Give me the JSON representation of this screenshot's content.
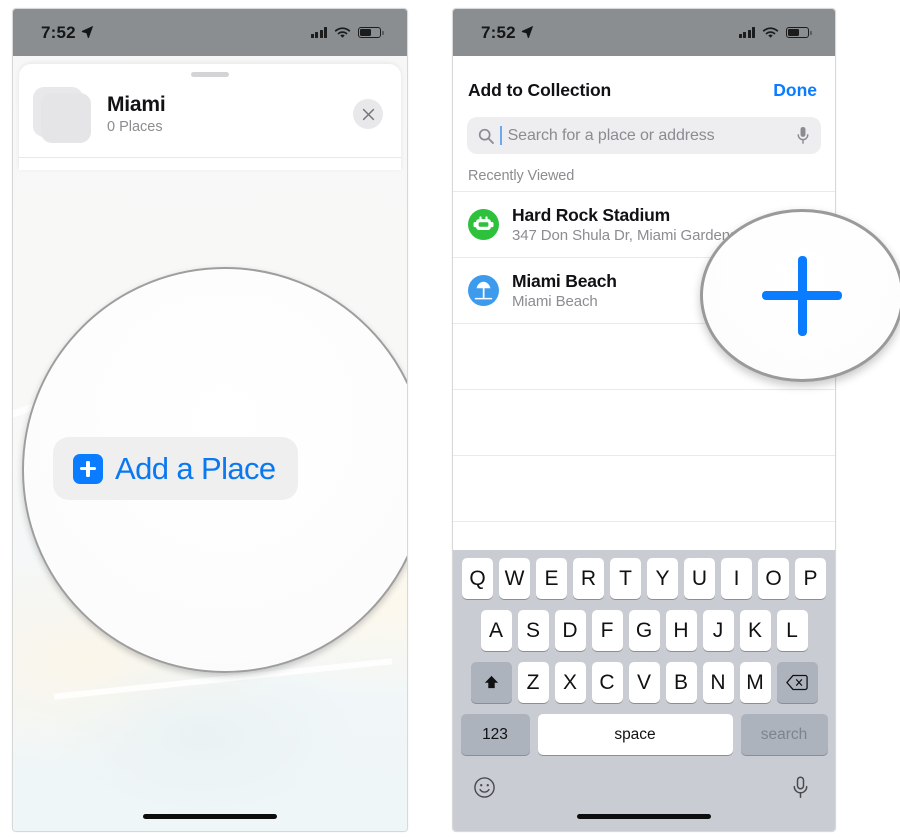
{
  "status_bar": {
    "time": "7:52",
    "location_arrow_icon": "location-arrow-icon",
    "cellular_icon": "cellular-bars-icon",
    "wifi_icon": "wifi-icon",
    "battery_icon": "battery-icon"
  },
  "left_screen": {
    "collection": {
      "title": "Miami",
      "subtitle": "0 Places",
      "close_icon": "close-icon",
      "thumbnail_icon": "collection-thumbnail-placeholder"
    },
    "add_place": {
      "label": "Add a Place",
      "plus_icon": "plus-square-icon"
    },
    "magnifier": "magnifier-circle-callout"
  },
  "right_screen": {
    "header": {
      "title": "Add to Collection",
      "done_label": "Done"
    },
    "search": {
      "placeholder": "Search for a place or address",
      "value": "",
      "search_icon": "search-icon",
      "mic_icon": "microphone-icon"
    },
    "section_header": "Recently Viewed",
    "results": [
      {
        "title": "Hard Rock Stadium",
        "subtitle": "347 Don Shula Dr, Miami Gardens",
        "icon": "stadium-icon",
        "icon_color": "#2ec13c"
      },
      {
        "title": "Miami Beach",
        "subtitle": "Miami Beach",
        "icon": "beach-umbrella-icon",
        "icon_color": "#3d9bed"
      }
    ],
    "magnifier_plus_icon": "plus-icon"
  },
  "keyboard": {
    "row1": [
      "Q",
      "W",
      "E",
      "R",
      "T",
      "Y",
      "U",
      "I",
      "O",
      "P"
    ],
    "row2": [
      "A",
      "S",
      "D",
      "F",
      "G",
      "H",
      "J",
      "K",
      "L"
    ],
    "row3": [
      "Z",
      "X",
      "C",
      "V",
      "B",
      "N",
      "M"
    ],
    "shift_icon": "shift-icon",
    "backspace_icon": "backspace-icon",
    "numbers_label": "123",
    "space_label": "space",
    "return_label": "search",
    "emoji_icon": "emoji-icon",
    "dictation_icon": "microphone-icon"
  },
  "colors": {
    "accent_blue": "#0a7cff",
    "status_bar_gray": "#8a8e91",
    "keyboard_bg": "#c9ccd2"
  }
}
